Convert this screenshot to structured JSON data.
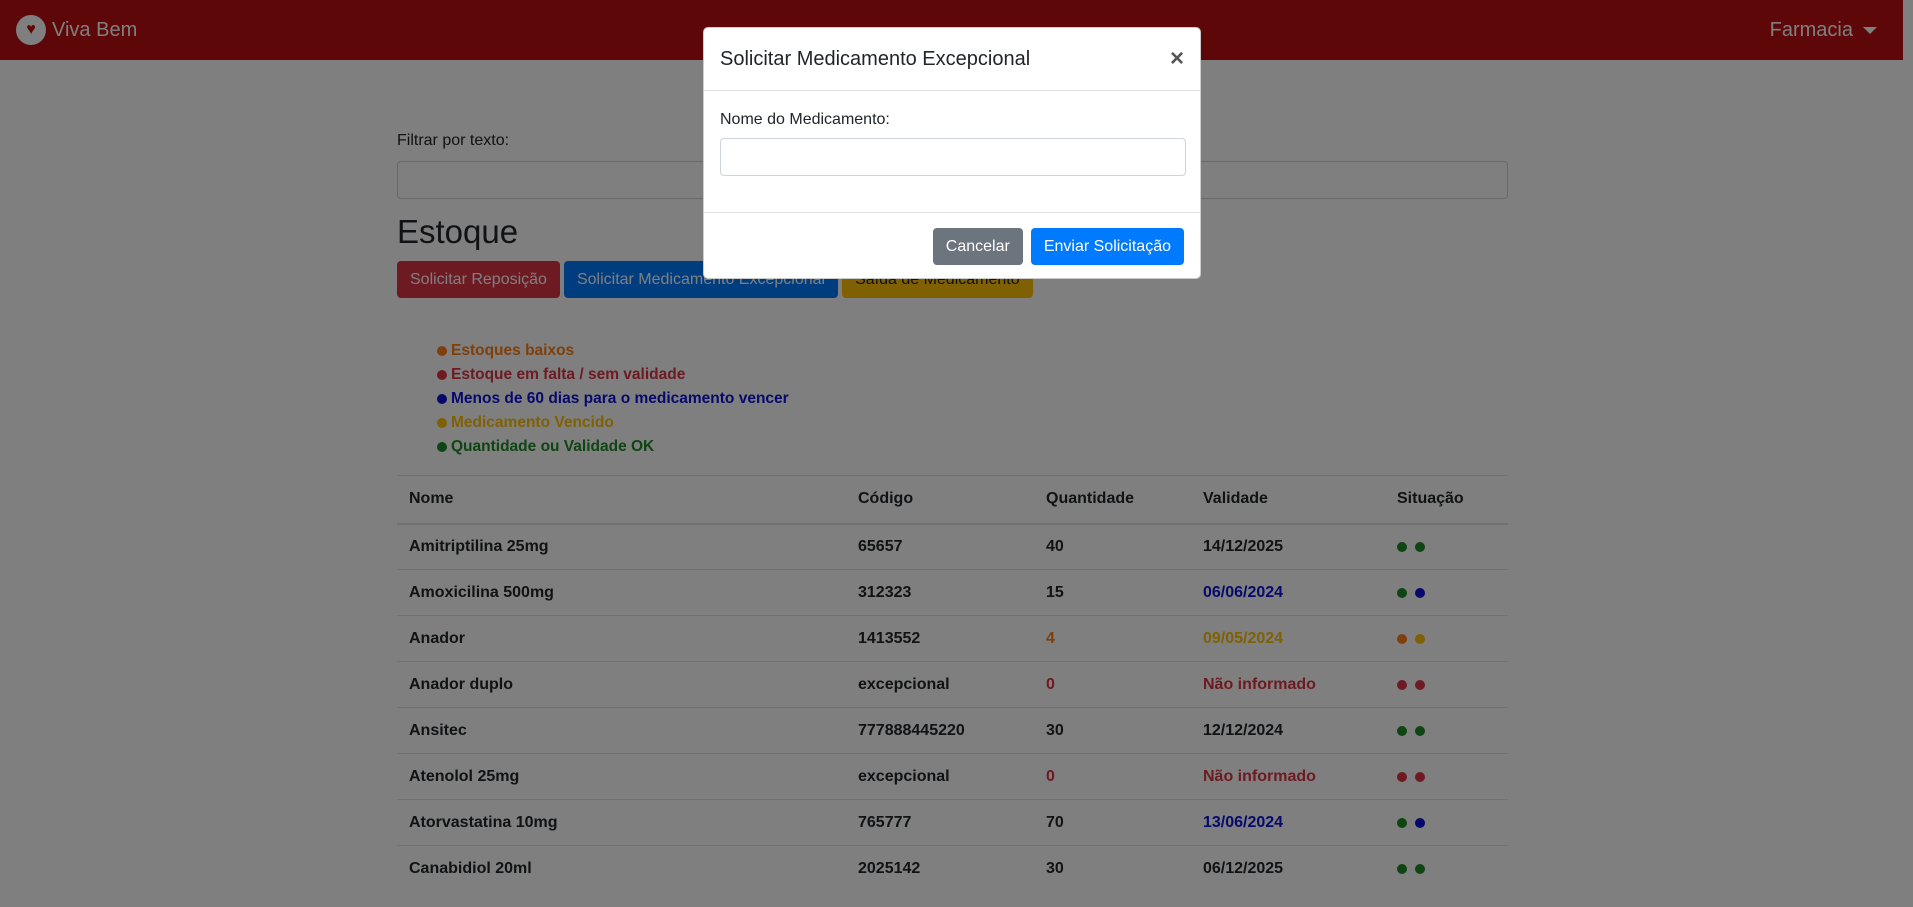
{
  "navbar": {
    "brand": "Viva Bem",
    "user_menu": "Farmacia"
  },
  "filter": {
    "label": "Filtrar por texto:",
    "value": ""
  },
  "page_title": "Estoque",
  "actions": {
    "restock": "Solicitar Reposição",
    "exceptional": "Solicitar Medicamento Excepcional",
    "withdraw": "Saída de Medicamento"
  },
  "colors": {
    "orange": "#fd7e14",
    "red": "#dc3545",
    "blue": "#0d12d9",
    "yellow": "#ffc107",
    "green": "#1f8a25"
  },
  "legend": [
    {
      "color": "orange",
      "text": "Estoques baixos"
    },
    {
      "color": "red",
      "text": "Estoque em falta / sem validade"
    },
    {
      "color": "blue",
      "text": "Menos de 60 dias para o medicamento vencer"
    },
    {
      "color": "yellow",
      "text": "Medicamento Vencido"
    },
    {
      "color": "green",
      "text": "Quantidade ou Validade OK"
    }
  ],
  "table": {
    "headers": [
      "Nome",
      "Código",
      "Quantidade",
      "Validade",
      "Situação"
    ],
    "rows": [
      {
        "name": "Amitriptilina 25mg",
        "code": "65657",
        "qty": "40",
        "qty_color": "default",
        "validity": "14/12/2025",
        "validity_color": "default",
        "dots": [
          "green",
          "green"
        ]
      },
      {
        "name": "Amoxicilina 500mg",
        "code": "312323",
        "qty": "15",
        "qty_color": "default",
        "validity": "06/06/2024",
        "validity_color": "blue",
        "dots": [
          "green",
          "blue"
        ]
      },
      {
        "name": "Anador",
        "code": "1413552",
        "qty": "4",
        "qty_color": "orange",
        "validity": "09/05/2024",
        "validity_color": "yellow",
        "dots": [
          "orange",
          "yellow"
        ]
      },
      {
        "name": "Anador duplo",
        "code": "excepcional",
        "qty": "0",
        "qty_color": "red",
        "validity": "Não informado",
        "validity_color": "red",
        "dots": [
          "red",
          "red"
        ]
      },
      {
        "name": "Ansitec",
        "code": "777888445220",
        "qty": "30",
        "qty_color": "default",
        "validity": "12/12/2024",
        "validity_color": "default",
        "dots": [
          "green",
          "green"
        ]
      },
      {
        "name": "Atenolol 25mg",
        "code": "excepcional",
        "qty": "0",
        "qty_color": "red",
        "validity": "Não informado",
        "validity_color": "red",
        "dots": [
          "red",
          "red"
        ]
      },
      {
        "name": "Atorvastatina 10mg",
        "code": "765777",
        "qty": "70",
        "qty_color": "default",
        "validity": "13/06/2024",
        "validity_color": "blue",
        "dots": [
          "green",
          "blue"
        ]
      },
      {
        "name": "Canabidiol 20ml",
        "code": "2025142",
        "qty": "30",
        "qty_color": "default",
        "validity": "06/12/2025",
        "validity_color": "default",
        "dots": [
          "green",
          "green"
        ]
      }
    ]
  },
  "modal": {
    "title": "Solicitar Medicamento Excepcional",
    "close": "×",
    "field_label": "Nome do Medicamento:",
    "field_value": "",
    "cancel": "Cancelar",
    "submit": "Enviar Solicitação"
  }
}
